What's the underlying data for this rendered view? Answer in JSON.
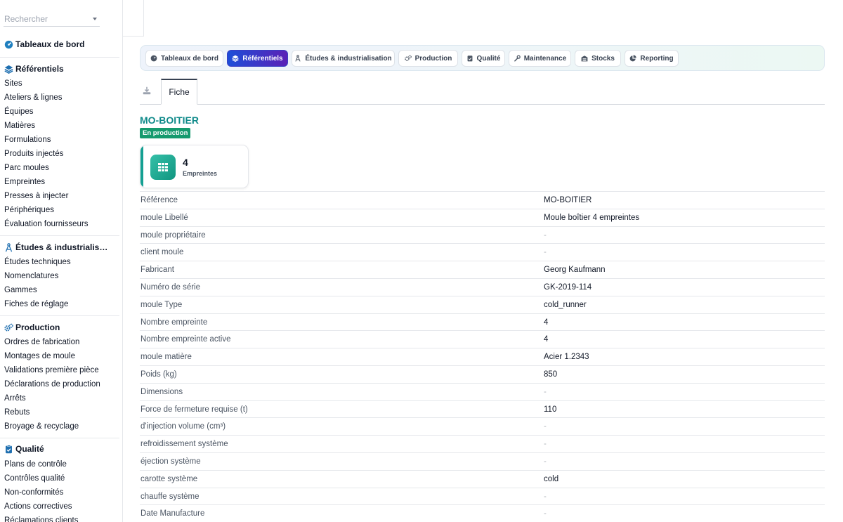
{
  "search": {
    "placeholder": "Rechercher"
  },
  "sidebar": {
    "dashboard": "Tableaux de bord",
    "referentiels": {
      "title": "Référentiels",
      "items": [
        "Sites",
        "Ateliers & lignes",
        "Équipes",
        "Matières",
        "Formulations",
        "Produits injectés",
        "Parc moules",
        "Empreintes",
        "Presses à injecter",
        "Périphériques",
        "Évaluation fournisseurs"
      ]
    },
    "etudes": {
      "title": "Études & industrialis…",
      "items": [
        "Études techniques",
        "Nomenclatures",
        "Gammes",
        "Fiches de réglage"
      ]
    },
    "production": {
      "title": "Production",
      "items": [
        "Ordres de fabrication",
        "Montages de moule",
        "Validations première pièce",
        "Déclarations de production",
        "Arrêts",
        "Rebuts",
        "Broyage & recyclage"
      ]
    },
    "qualite": {
      "title": "Qualité",
      "items": [
        "Plans de contrôle",
        "Contrôles qualité",
        "Non-conformités",
        "Actions correctives",
        "Réclamations clients"
      ]
    }
  },
  "nav": {
    "tabs": [
      {
        "label": "Tableaux de bord",
        "icon": "gauge-icon"
      },
      {
        "label": "Référentiels",
        "icon": "layers-icon",
        "active": true
      },
      {
        "label": "Études & industrialisation",
        "icon": "compass-icon"
      },
      {
        "label": "Production",
        "icon": "gears-icon"
      },
      {
        "label": "Qualité",
        "icon": "clipboard-check-icon"
      },
      {
        "label": "Maintenance",
        "icon": "wrench-icon"
      },
      {
        "label": "Stocks",
        "icon": "warehouse-icon"
      },
      {
        "label": "Reporting",
        "icon": "pie-chart-icon"
      }
    ]
  },
  "subtabs": {
    "fiche": "Fiche"
  },
  "record": {
    "title": "MO-BOITIER",
    "status": "En production",
    "kpi": {
      "value": "4",
      "label": "Empreintes"
    },
    "fields": [
      {
        "label": "Référence",
        "value": "MO-BOITIER"
      },
      {
        "label": "moule Libellé",
        "value": "Moule boîtier 4 empreintes"
      },
      {
        "label": "moule propriétaire",
        "value": "-"
      },
      {
        "label": "client moule",
        "value": "-"
      },
      {
        "label": "Fabricant",
        "value": "Georg Kaufmann"
      },
      {
        "label": "Numéro de série",
        "value": "GK-2019-114"
      },
      {
        "label": "moule Type",
        "value": "cold_runner"
      },
      {
        "label": "Nombre empreinte",
        "value": "4"
      },
      {
        "label": "Nombre empreinte active",
        "value": "4"
      },
      {
        "label": "moule matière",
        "value": "Acier 1.2343"
      },
      {
        "label": "Poids (kg)",
        "value": "850"
      },
      {
        "label": "Dimensions",
        "value": "-"
      },
      {
        "label": "Force de fermeture requise (t)",
        "value": "110"
      },
      {
        "label": "d'injection volume (cm³)",
        "value": "-"
      },
      {
        "label": "refroidissement système",
        "value": "-"
      },
      {
        "label": "éjection système",
        "value": "-"
      },
      {
        "label": "carotte système",
        "value": "cold"
      },
      {
        "label": "chauffe système",
        "value": "-"
      },
      {
        "label": "Date Manufacture",
        "value": "-"
      }
    ]
  },
  "colors": {
    "accent": "#0f8a8a",
    "status": "#159a6e",
    "active_tab_start": "#1d4ed8",
    "active_tab_end": "#5b21b6"
  }
}
